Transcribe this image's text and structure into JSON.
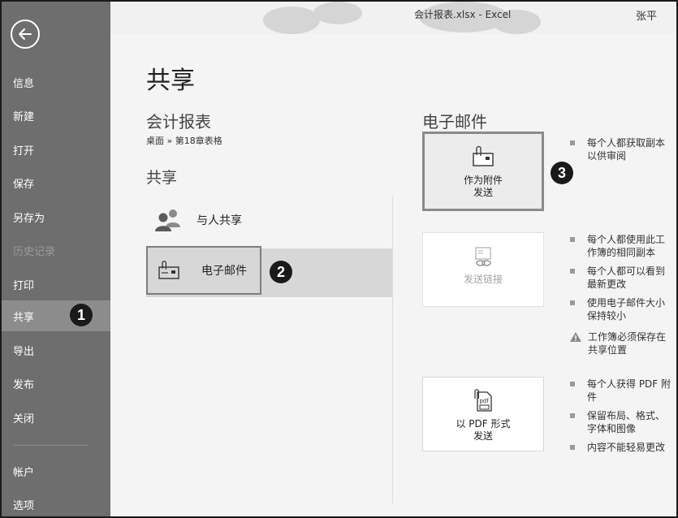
{
  "window": {
    "title": "会计报表.xlsx - Excel",
    "user": "张平",
    "help": "?",
    "minimize": "–"
  },
  "nav": {
    "items": [
      {
        "label": "信息"
      },
      {
        "label": "新建"
      },
      {
        "label": "打开"
      },
      {
        "label": "保存"
      },
      {
        "label": "另存为"
      },
      {
        "label": "历史记录"
      },
      {
        "label": "打印"
      },
      {
        "label": "共享"
      },
      {
        "label": "导出"
      },
      {
        "label": "发布"
      },
      {
        "label": "关闭"
      },
      {
        "label": "帐户"
      },
      {
        "label": "选项"
      }
    ]
  },
  "page": {
    "title": "共享",
    "doc_name": "会计报表",
    "breadcrumb": "桌面 » 第18章表格",
    "section_title": "共享",
    "share_people": "与人共享",
    "email": "电子邮件"
  },
  "right": {
    "title": "电子邮件",
    "attach_button": "作为附件\n发送",
    "link_button": "发送链接",
    "pdf_button": "以 PDF 形式\n发送",
    "attach_bullets": [
      "每个人都获取副本以供审阅"
    ],
    "link_bullets": [
      "每个人都使用此工作簿的相同副本",
      "每个人都可以看到最新更改",
      "使用电子邮件大小保持较小"
    ],
    "link_warning": "工作簿必须保存在共享位置",
    "pdf_bullets": [
      "每个人获得 PDF 附件",
      "保留布局、格式、字体和图像",
      "内容不能轻易更改"
    ]
  },
  "badges": [
    "1",
    "2",
    "3"
  ],
  "colors": {
    "nav_bg": "#6e6e6e",
    "nav_active": "#8c8c8c",
    "content_bg": "#f4f4f4",
    "selection_bg": "#d7d7d7",
    "badge": "#1a1a1a"
  }
}
